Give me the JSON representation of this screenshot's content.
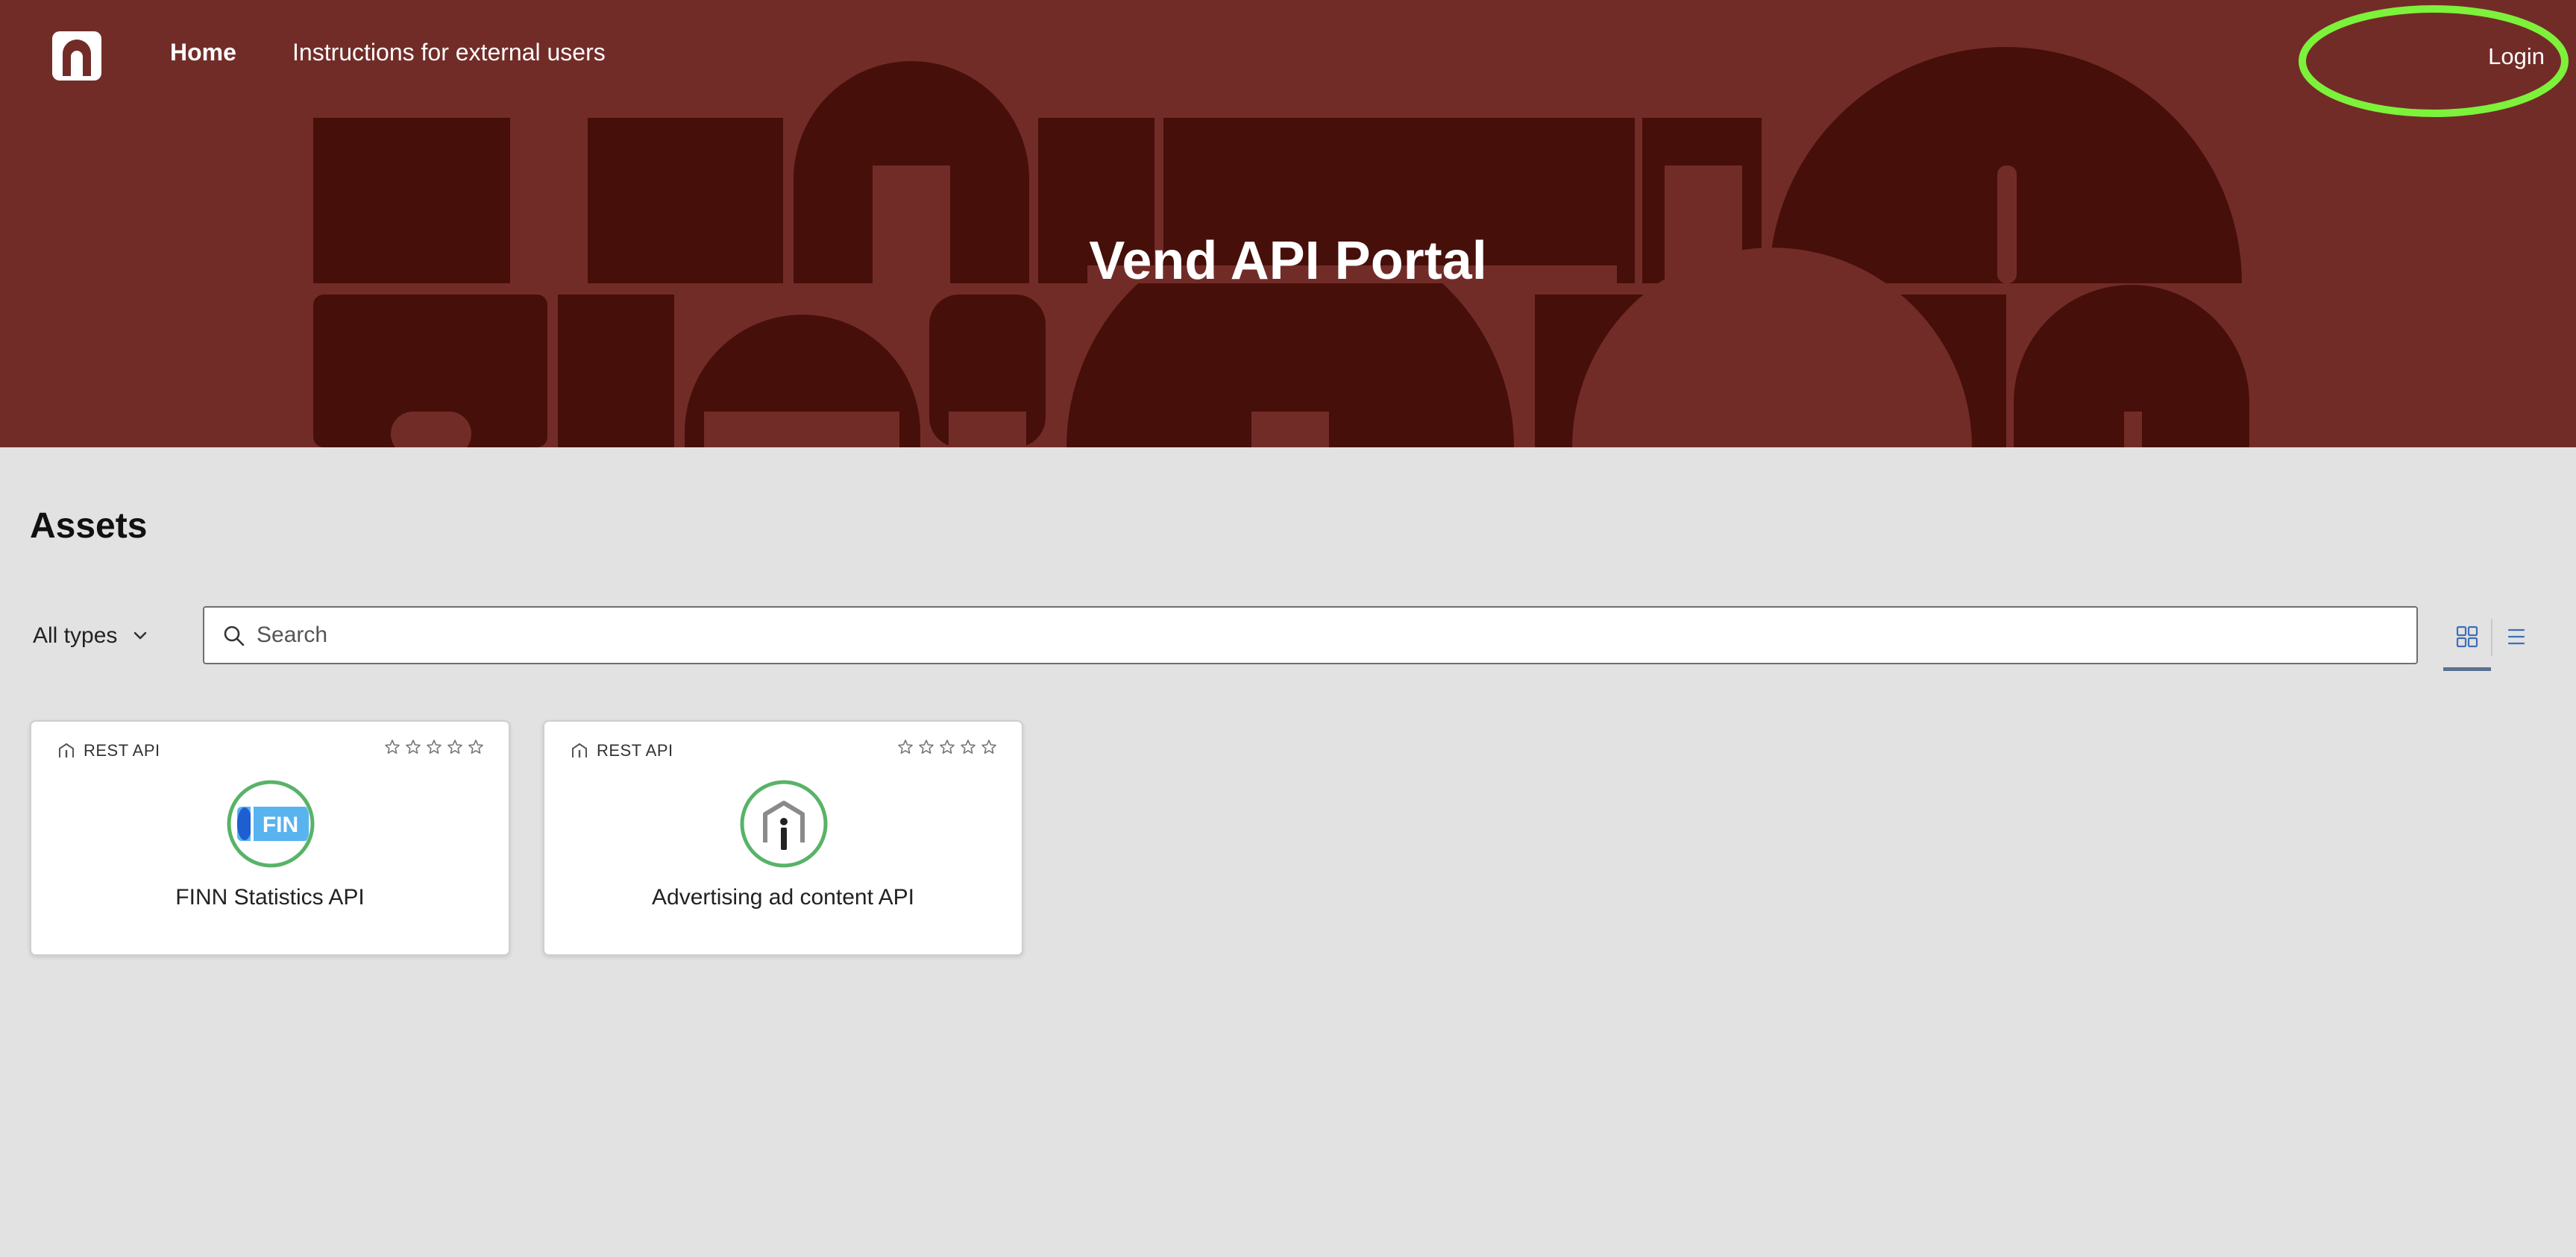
{
  "nav": {
    "home_label": "Home",
    "instructions_label": "Instructions for external users",
    "login_label": "Login"
  },
  "hero": {
    "title": "Vend API Portal"
  },
  "assets": {
    "section_title": "Assets",
    "type_filter_label": "All types",
    "search_placeholder": "Search",
    "search_value": "",
    "view_modes": [
      "grid-icon",
      "list-icon"
    ],
    "selected_view": "grid"
  },
  "cards": [
    {
      "type_label": "REST API",
      "title": "FINN Statistics API",
      "rating": 0,
      "rating_max": 5,
      "logo": "finn-logo",
      "logo_text": "FIN"
    },
    {
      "type_label": "REST API",
      "title": "Advertising ad content API",
      "rating": 0,
      "rating_max": 5,
      "logo": "api-house-logo"
    }
  ],
  "colors": {
    "header_bg": "#722c28",
    "hero_shapes": "#470f0a",
    "page_bg": "#e2e2e2",
    "login_highlight": "#7cf23a",
    "logo_ring": "#58b368",
    "finn_blue": "#58b3ef",
    "finn_dark_blue": "#1d5fd1",
    "view_accent": "#5b7190"
  }
}
